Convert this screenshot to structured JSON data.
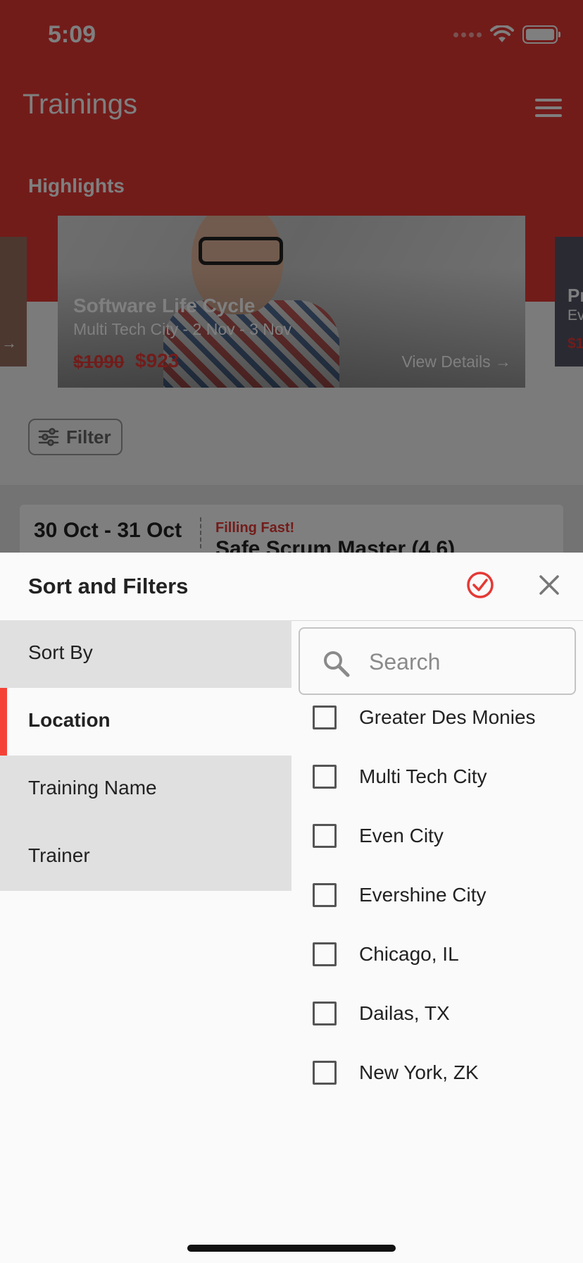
{
  "status": {
    "time": "5:09"
  },
  "header": {
    "title": "Trainings",
    "highlights_label": "Highlights"
  },
  "highlight_card": {
    "title": "Software Life Cycle",
    "subtitle": "Multi Tech City - 2 Nov - 3 Nov",
    "old_price": "$1090",
    "new_price": "$923",
    "view_details": "View Details →"
  },
  "side_card_right": {
    "title": "Pr",
    "subtitle": "Ev",
    "price": "$1"
  },
  "side_card_left": {
    "arrow": "→"
  },
  "filter_chip": {
    "label": "Filter"
  },
  "list_item": {
    "date": "30 Oct - 31 Oct",
    "badge": "Filling Fast!",
    "name": "Safe Scrum Master (4.6)"
  },
  "sheet": {
    "title": "Sort and Filters",
    "tabs": [
      {
        "label": "Sort By",
        "active": false
      },
      {
        "label": "Location",
        "active": true
      },
      {
        "label": "Training Name",
        "active": false
      },
      {
        "label": "Trainer",
        "active": false
      }
    ],
    "search": {
      "placeholder": "Search",
      "value": ""
    },
    "options": [
      {
        "label": "Greater Des Monies",
        "checked": false
      },
      {
        "label": "Multi Tech City",
        "checked": false
      },
      {
        "label": "Even City",
        "checked": false
      },
      {
        "label": "Evershine City",
        "checked": false
      },
      {
        "label": "Chicago, IL",
        "checked": false
      },
      {
        "label": "Dailas, TX",
        "checked": false
      },
      {
        "label": "New York, ZK",
        "checked": false
      }
    ]
  },
  "icons": [
    "wifi-icon",
    "battery-icon",
    "menu-icon",
    "filter-icon",
    "check-circle-icon",
    "close-icon",
    "search-icon"
  ],
  "colors": {
    "primary": "#e53935",
    "active_indicator": "#f44336",
    "tab_bg": "#e0e0e0",
    "sheet_bg": "#fafafa"
  }
}
